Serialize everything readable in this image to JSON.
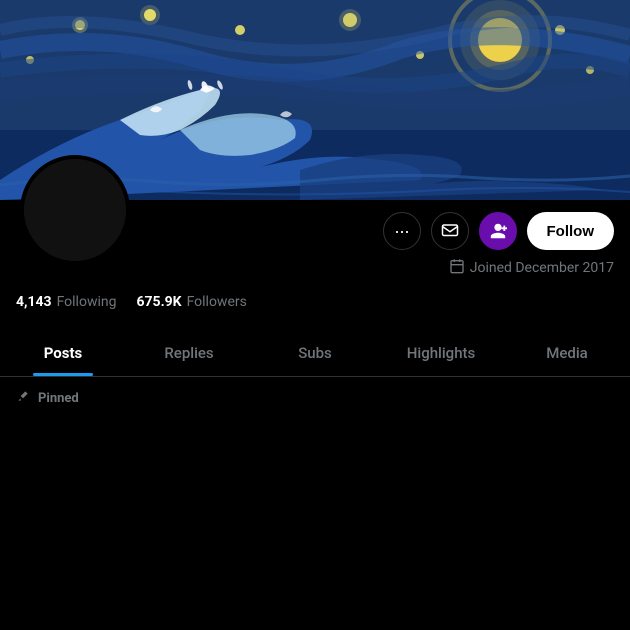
{
  "banner": {
    "alt": "Starry night wave mashup banner"
  },
  "avatar": {
    "alt": "Profile avatar"
  },
  "buttons": {
    "more_label": "•••",
    "message_label": "✉",
    "subscribe_label": "👤+",
    "follow_label": "Follow"
  },
  "joined": {
    "icon": "📅",
    "text": "Joined December 2017"
  },
  "stats": {
    "following_count": "4,143",
    "following_label": "Following",
    "followers_count": "675.9K",
    "followers_label": "Followers"
  },
  "tabs": [
    {
      "id": "posts",
      "label": "Posts",
      "active": true
    },
    {
      "id": "replies",
      "label": "Replies",
      "active": false
    },
    {
      "id": "subs",
      "label": "Subs",
      "active": false
    },
    {
      "id": "highlights",
      "label": "Highlights",
      "active": false
    },
    {
      "id": "media",
      "label": "Media",
      "active": false
    }
  ],
  "pinned": {
    "icon": "📌",
    "label": "Pinned"
  }
}
